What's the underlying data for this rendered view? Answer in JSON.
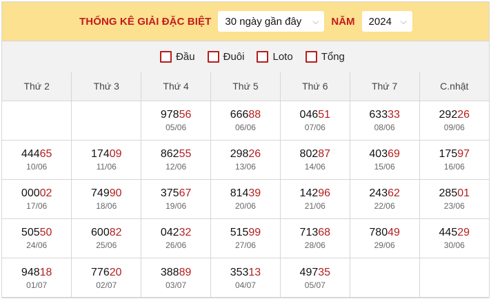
{
  "header": {
    "title": "THỐNG KÊ GIẢI ĐẶC BIỆT",
    "range_select": "30 ngày gần đây",
    "year_label": "NĂM",
    "year_select": "2024"
  },
  "filters": [
    {
      "label": "Đầu",
      "checked": false
    },
    {
      "label": "Đuôi",
      "checked": false
    },
    {
      "label": "Loto",
      "checked": false
    },
    {
      "label": "Tổng",
      "checked": false
    }
  ],
  "weekdays": [
    "Thứ 2",
    "Thứ 3",
    "Thứ 4",
    "Thứ 5",
    "Thứ 6",
    "Thứ 7",
    "C.nhật"
  ],
  "rows": [
    [
      null,
      null,
      {
        "head": "978",
        "tail": "56",
        "date": "05/06"
      },
      {
        "head": "666",
        "tail": "88",
        "date": "06/06"
      },
      {
        "head": "046",
        "tail": "51",
        "date": "07/06"
      },
      {
        "head": "633",
        "tail": "33",
        "date": "08/06"
      },
      {
        "head": "292",
        "tail": "26",
        "date": "09/06"
      }
    ],
    [
      {
        "head": "444",
        "tail": "65",
        "date": "10/06"
      },
      {
        "head": "174",
        "tail": "09",
        "date": "11/06"
      },
      {
        "head": "862",
        "tail": "55",
        "date": "12/06"
      },
      {
        "head": "298",
        "tail": "26",
        "date": "13/06"
      },
      {
        "head": "802",
        "tail": "87",
        "date": "14/06"
      },
      {
        "head": "403",
        "tail": "69",
        "date": "15/06"
      },
      {
        "head": "175",
        "tail": "97",
        "date": "16/06"
      }
    ],
    [
      {
        "head": "000",
        "tail": "02",
        "date": "17/06"
      },
      {
        "head": "749",
        "tail": "90",
        "date": "18/06"
      },
      {
        "head": "375",
        "tail": "67",
        "date": "19/06"
      },
      {
        "head": "814",
        "tail": "39",
        "date": "20/06"
      },
      {
        "head": "142",
        "tail": "96",
        "date": "21/06"
      },
      {
        "head": "243",
        "tail": "62",
        "date": "22/06"
      },
      {
        "head": "285",
        "tail": "01",
        "date": "23/06"
      }
    ],
    [
      {
        "head": "505",
        "tail": "50",
        "date": "24/06"
      },
      {
        "head": "600",
        "tail": "82",
        "date": "25/06"
      },
      {
        "head": "042",
        "tail": "32",
        "date": "26/06"
      },
      {
        "head": "515",
        "tail": "99",
        "date": "27/06"
      },
      {
        "head": "713",
        "tail": "68",
        "date": "28/06"
      },
      {
        "head": "780",
        "tail": "49",
        "date": "29/06"
      },
      {
        "head": "445",
        "tail": "29",
        "date": "30/06"
      }
    ],
    [
      {
        "head": "948",
        "tail": "18",
        "date": "01/07"
      },
      {
        "head": "776",
        "tail": "20",
        "date": "02/07"
      },
      {
        "head": "388",
        "tail": "89",
        "date": "03/07"
      },
      {
        "head": "353",
        "tail": "13",
        "date": "04/07"
      },
      {
        "head": "497",
        "tail": "35",
        "date": "05/07"
      },
      null,
      null
    ]
  ]
}
